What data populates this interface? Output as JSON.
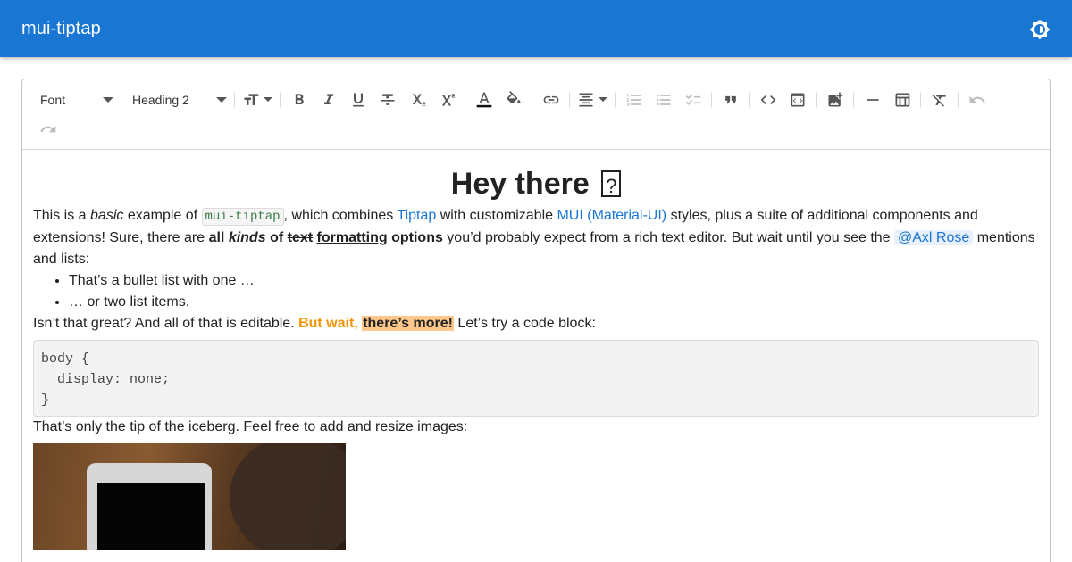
{
  "app": {
    "title": "mui-tiptap"
  },
  "toolbar": {
    "font_select": "Font",
    "heading_select": "Heading 2"
  },
  "content": {
    "heading": "Hey there",
    "p1": {
      "t1": "This is a ",
      "basic": "basic",
      "t2": " example of ",
      "code": "mui-tiptap",
      "t3": ", which combines ",
      "link1": "Tiptap",
      "t4": " with customizable ",
      "link2": "MUI (Material-UI)",
      "t5": " styles, plus a suite of additional components and extensions! Sure, there are ",
      "all": "all",
      "kinds": "kinds",
      "of": "of",
      "text": "text",
      "formatting": "formatting",
      "options": "options",
      "t6": " you’d probably expect from a rich text editor. But wait until you see the ",
      "mention": "@Axl Rose",
      "t7": " mentions and lists:"
    },
    "bullets": [
      "That’s a bullet list with one …",
      "… or two list items."
    ],
    "p2": {
      "t1": "Isn’t that great? And all of that is editable. ",
      "orange": "But wait,",
      "highlight": "there’s more!",
      "t2": " Let’s try a code block:"
    },
    "code_block": "body {\n  display: none;\n}",
    "p3": "That’s only the tip of the iceberg. Feel free to add and resize images:"
  },
  "colors": {
    "appbar": "#1976d2",
    "link": "#1976d2",
    "orange_text": "#f59400",
    "highlight": "#ffc88a"
  }
}
